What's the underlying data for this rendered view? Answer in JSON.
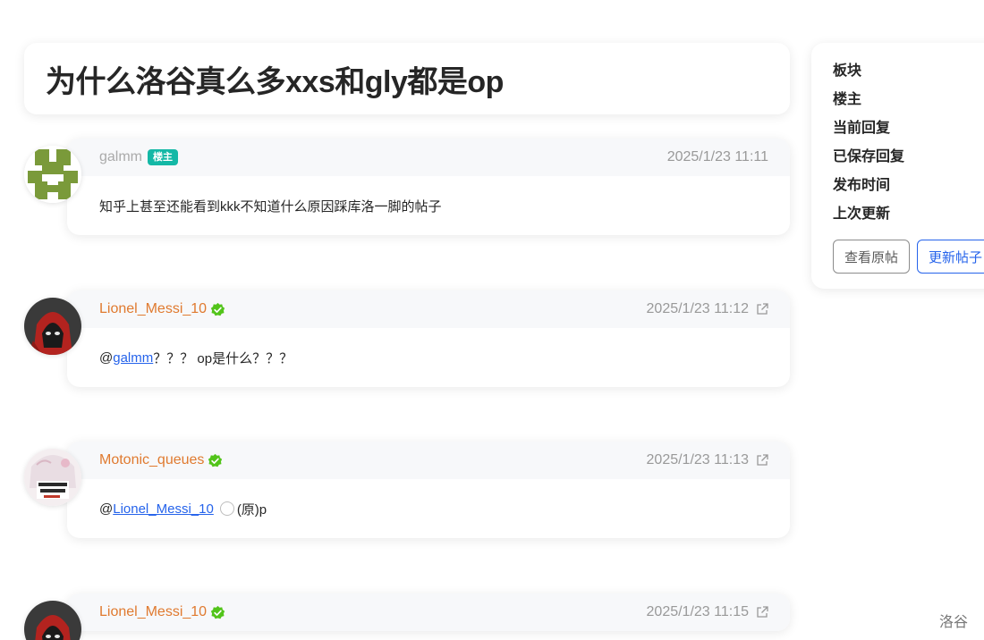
{
  "post": {
    "title": "为什么洛谷真么多xxs和gly都是op"
  },
  "replies": [
    {
      "user": "galmm",
      "badge": "楼主",
      "time": "2025/1/23 11:11",
      "content": "知乎上甚至还能看到kkk不知道什么原因踩库洛一脚的帖子"
    },
    {
      "user": "Lionel_Messi_10",
      "time": "2025/1/23 11:12",
      "mention_prefix": "@",
      "mention": "galmm",
      "content_after": "？？？ op是什么？？？"
    },
    {
      "user": "Motonic_queues",
      "time": "2025/1/23 11:13",
      "mention_prefix": "@",
      "mention": "Lionel_Messi_10",
      "content_after": "(原)p"
    },
    {
      "user": "Lionel_Messi_10",
      "time": "2025/1/23 11:15"
    }
  ],
  "sidebar": {
    "items": [
      "板块",
      "楼主",
      "当前回复",
      "已保存回复",
      "发布时间",
      "上次更新"
    ],
    "view_original": "查看原帖",
    "update_post": "更新帖子"
  },
  "footer": {
    "mark": "洛谷"
  },
  "colors": {
    "username_accent": "#e07a2f",
    "badge_bg": "#14b8a6",
    "verified_green": "#52c41a",
    "link_blue": "#2563eb"
  }
}
